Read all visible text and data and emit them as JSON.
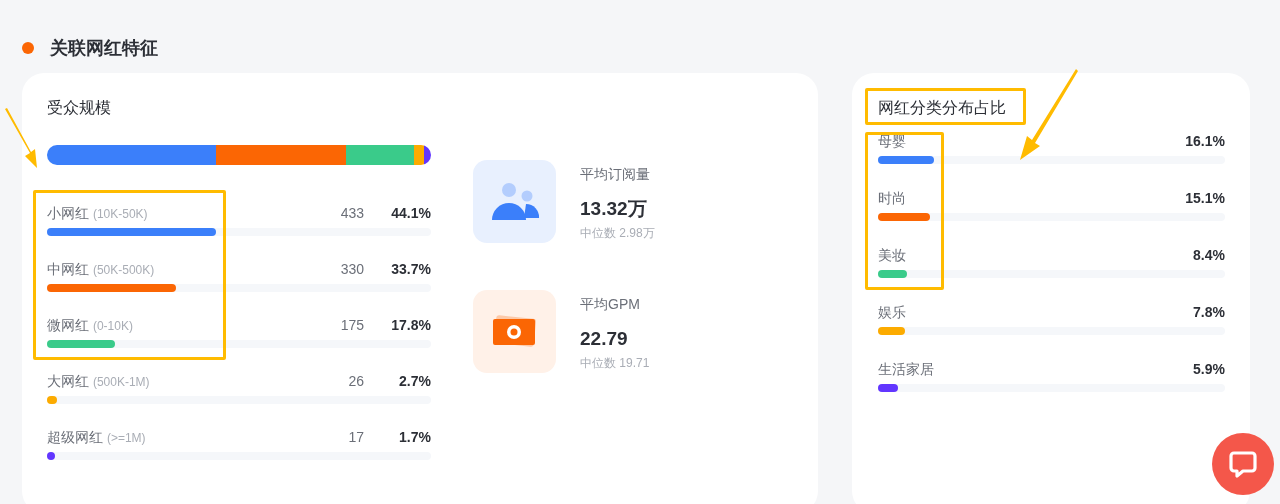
{
  "section_title": "关联网红特征",
  "audience": {
    "title": "受众规模",
    "tiers": [
      {
        "name": "小网红",
        "range": "(10K-50K)",
        "count": "433",
        "percent": "44.1%",
        "level": 0.441,
        "color": "#3b7ffa"
      },
      {
        "name": "中网红",
        "range": "(50K-500K)",
        "count": "330",
        "percent": "33.7%",
        "level": 0.337,
        "color": "#fb6604"
      },
      {
        "name": "微网红",
        "range": "(0-10K)",
        "count": "175",
        "percent": "17.8%",
        "level": 0.178,
        "color": "#3acb8a"
      },
      {
        "name": "大网红",
        "range": "(500K-1M)",
        "count": "26",
        "percent": "2.7%",
        "level": 0.027,
        "color": "#fcab00"
      },
      {
        "name": "超级网红",
        "range": "(>=1M)",
        "count": "17",
        "percent": "1.7%",
        "level": 0.017,
        "color": "#6236ff"
      }
    ]
  },
  "stats": [
    {
      "kind": "subscribers",
      "label": "平均订阅量",
      "value": "13.32万",
      "median": "中位数 2.98万"
    },
    {
      "kind": "gpm",
      "label": "平均GPM",
      "value": "22.79",
      "median": "中位数 19.71"
    }
  ],
  "categories": {
    "title": "网红分类分布占比",
    "items": [
      {
        "name": "母婴",
        "percent": "16.1%",
        "level": 0.161,
        "color": "#3b7ffa"
      },
      {
        "name": "时尚",
        "percent": "15.1%",
        "level": 0.151,
        "color": "#fb6604"
      },
      {
        "name": "美妆",
        "percent": "8.4%",
        "level": 0.084,
        "color": "#3acb8a"
      },
      {
        "name": "娱乐",
        "percent": "7.8%",
        "level": 0.078,
        "color": "#fcab00"
      },
      {
        "name": "生活家居",
        "percent": "5.9%",
        "level": 0.059,
        "color": "#6236ff"
      }
    ]
  }
}
